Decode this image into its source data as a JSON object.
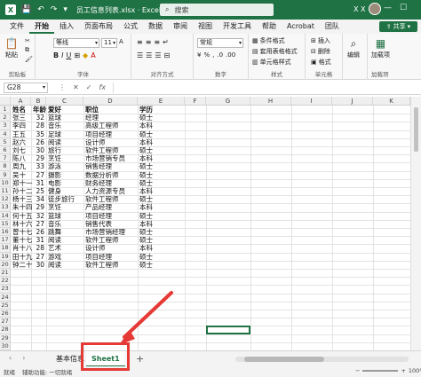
{
  "titlebar": {
    "app_letter": "X",
    "doc_title": "员工信息列表.xlsx · Excel",
    "search_placeholder": "搜索",
    "user_initials": "X X"
  },
  "menu": {
    "tabs": [
      "文件",
      "开始",
      "插入",
      "页面布局",
      "公式",
      "数据",
      "审阅",
      "视图",
      "开发工具",
      "帮助",
      "Acrobat",
      "团队"
    ],
    "active_tab": "开始",
    "share_label": "共享"
  },
  "ribbon": {
    "clipboard": {
      "paste": "粘贴",
      "label": "剪贴板"
    },
    "font": {
      "name": "等线",
      "size": "11",
      "label": "字体"
    },
    "alignment": {
      "label": "对齐方式"
    },
    "number": {
      "format": "常规",
      "label": "数字"
    },
    "styles": {
      "conditional": "条件格式",
      "table": "套用表格格式",
      "cell": "单元格样式",
      "label": "样式"
    },
    "cells": {
      "insert": "插入",
      "delete": "删除",
      "format": "格式",
      "label": "单元格"
    },
    "editing": {
      "edit": "编辑",
      "label": ""
    },
    "addins": {
      "add": "加载项",
      "label": "加载项"
    }
  },
  "formula_bar": {
    "name_box": "G28",
    "fx": "fx"
  },
  "grid": {
    "columns": [
      "A",
      "B",
      "C",
      "D",
      "E",
      "F",
      "G",
      "H",
      "I",
      "J",
      "K"
    ],
    "header": [
      "姓名",
      "年龄",
      "爱好",
      "职位",
      "学历"
    ],
    "rows": [
      [
        "张三",
        "32",
        "篮球",
        "经理",
        "硕士"
      ],
      [
        "李四",
        "28",
        "音乐",
        "高级工程师",
        "本科"
      ],
      [
        "王五",
        "35",
        "足球",
        "项目经理",
        "硕士"
      ],
      [
        "赵六",
        "26",
        "阅读",
        "设计师",
        "本科"
      ],
      [
        "刘七",
        "30",
        "旅行",
        "软件工程师",
        "硕士"
      ],
      [
        "陈八",
        "29",
        "烹饪",
        "市场营销专员",
        "本科"
      ],
      [
        "周九",
        "33",
        "游泳",
        "销售经理",
        "硕士"
      ],
      [
        "吴十",
        "27",
        "摄影",
        "数据分析师",
        "硕士"
      ],
      [
        "郑十一",
        "31",
        "电影",
        "财务经理",
        "硕士"
      ],
      [
        "孙十二",
        "25",
        "健身",
        "人力资源专员",
        "本科"
      ],
      [
        "杨十三",
        "34",
        "徒步旅行",
        "软件工程师",
        "硕士"
      ],
      [
        "朱十四",
        "29",
        "烹饪",
        "产品经理",
        "本科"
      ],
      [
        "何十五",
        "32",
        "篮球",
        "项目经理",
        "硕士"
      ],
      [
        "林十六",
        "27",
        "音乐",
        "销售代表",
        "本科"
      ],
      [
        "曾十七",
        "26",
        "跳舞",
        "市场营销经理",
        "硕士"
      ],
      [
        "董十七",
        "31",
        "阅读",
        "软件工程师",
        "硕士"
      ],
      [
        "肖十八",
        "28",
        "艺术",
        "设计师",
        "本科"
      ],
      [
        "田十九",
        "27",
        "游戏",
        "项目经理",
        "硕士"
      ],
      [
        "钟二十",
        "30",
        "阅读",
        "软件工程师",
        "硕士"
      ]
    ],
    "row_numbers": [
      "1",
      "2",
      "3",
      "4",
      "5",
      "6",
      "7",
      "8",
      "9",
      "10",
      "11",
      "12",
      "13",
      "14",
      "15",
      "16",
      "17",
      "18",
      "19",
      "20",
      "21",
      "22",
      "23",
      "24",
      "25",
      "26",
      "27",
      "28",
      "29",
      "30"
    ]
  },
  "sheets": {
    "tabs": [
      "基本信息",
      "Sheet1"
    ],
    "active": "Sheet1",
    "add": "+"
  },
  "status": {
    "ready": "就绪",
    "accessibility": "辅助功能: 一切就绪",
    "zoom": "100%"
  },
  "colors": {
    "excel_green": "#1f7244",
    "annotation_red": "#e53935"
  }
}
